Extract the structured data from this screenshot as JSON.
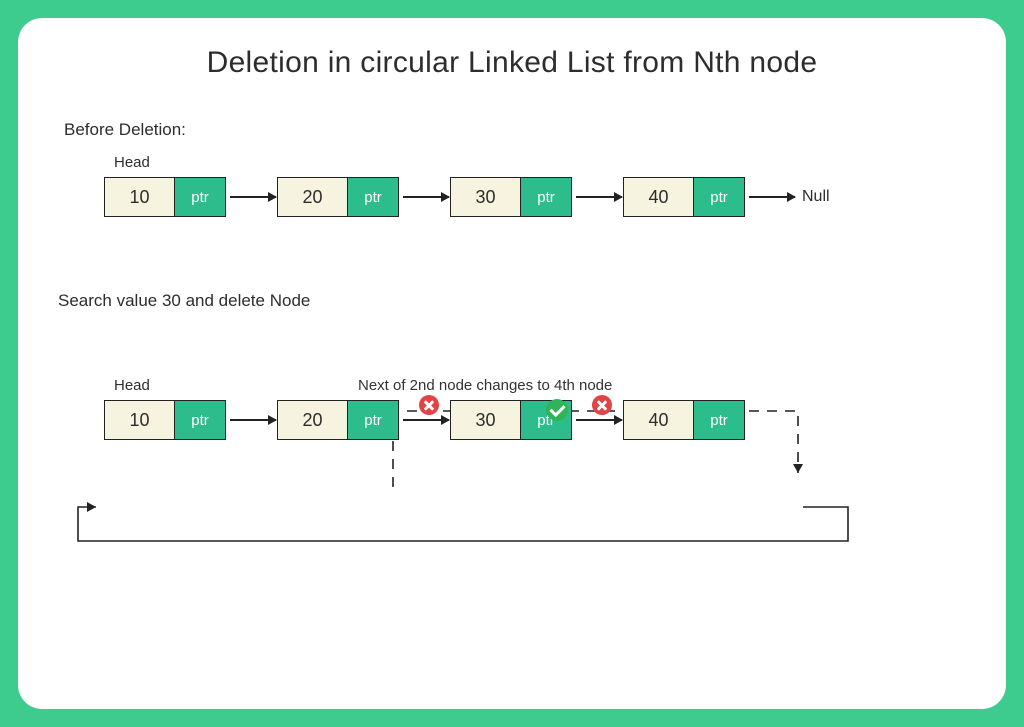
{
  "title": "Deletion in circular Linked List from Nth node",
  "stage1": {
    "label": "Before Deletion:",
    "head_label": "Head",
    "ptr_label": "ptr",
    "null_label": "Null",
    "nodes": [
      "10",
      "20",
      "30",
      "40"
    ]
  },
  "stage2": {
    "label": "Search value 30 and delete Node",
    "head_label": "Head",
    "ptr_label": "ptr",
    "note": "Next of 2nd  node changes to 4th node",
    "nodes": [
      "10",
      "20",
      "30",
      "40"
    ]
  }
}
